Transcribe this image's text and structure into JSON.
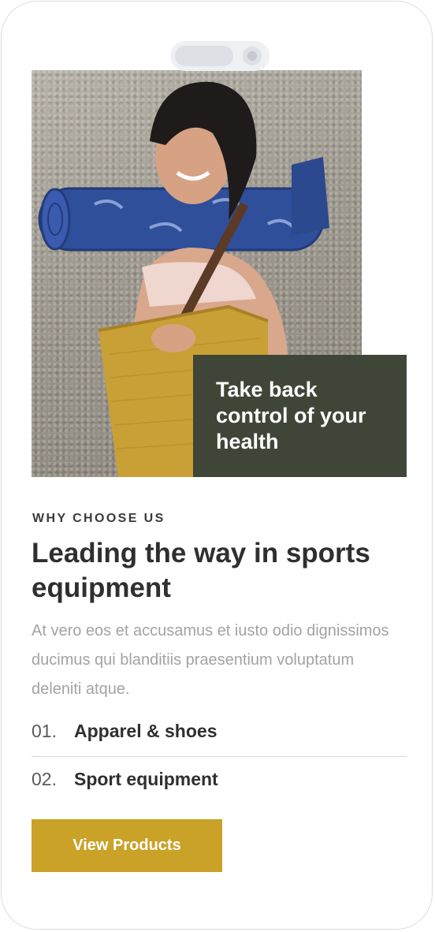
{
  "hero": {
    "headline": "Take back control of your health"
  },
  "section": {
    "eyebrow": "WHY CHOOSE US",
    "title": "Leading the way in sports equipment",
    "description": "At vero eos et accusamus et iusto odio dignissimos ducimus qui blanditiis praesentium voluptatum deleniti atque."
  },
  "features": [
    {
      "num": "01.",
      "label": "Apparel & shoes"
    },
    {
      "num": "02.",
      "label": "Sport equipment"
    }
  ],
  "cta": {
    "label": "View Products"
  },
  "colors": {
    "card": "#3f4637",
    "accent": "#c9a227",
    "title": "#2f2f2f",
    "muted": "#a3a3a3"
  }
}
